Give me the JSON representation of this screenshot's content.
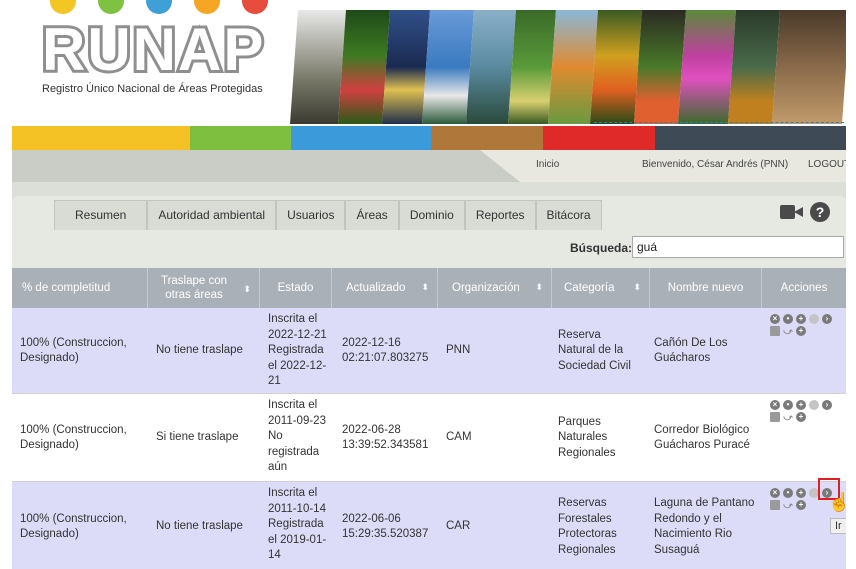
{
  "brand": {
    "logo_text": "RUNAP",
    "subtitle": "Registro Único Nacional de Áreas Protegidas",
    "circle_colors": [
      "#f3c623",
      "#7fc242",
      "#3fa0d8",
      "#f5a623",
      "#e74c3c"
    ],
    "colorbar": [
      "#f5c226",
      "#7fbf3f",
      "#3b9ad9",
      "#b0773a",
      "#e02a2a",
      "#3e4a56"
    ]
  },
  "topnav": {
    "home": "Inicio",
    "welcome": "Bienvenido, César Andrés (PNN)",
    "logout": "LOGOUT"
  },
  "tabs": [
    "Resumen",
    "Autoridad ambiental",
    "Usuarios",
    "Áreas",
    "Dominio",
    "Reportes",
    "Bitácora"
  ],
  "toolbar": {
    "video_icon": "video-camera-icon",
    "help_icon": "help-icon",
    "help_glyph": "?"
  },
  "search": {
    "label": "Búsqueda:",
    "value": "guá"
  },
  "table": {
    "headers": [
      "% de completitud",
      "Traslape con otras áreas",
      "Estado",
      "Actualizado",
      "Organización",
      "Categoría",
      "Nombre nuevo",
      "Acciones"
    ],
    "header_line2": "otras áreas",
    "header_line1": "Traslape con",
    "sortable": [
      false,
      true,
      false,
      true,
      true,
      true,
      false,
      false
    ],
    "header_color": "#aab0b8",
    "odd_row_color": "#dcdcf8",
    "rows": [
      {
        "completitud": [
          "100% (Construccion,",
          "Designado)"
        ],
        "traslape": "No tiene traslape",
        "estado": [
          "Inscrita el",
          "2022-12-21",
          "Registrada",
          "el 2022-12-",
          "21"
        ],
        "actualizado": [
          "2022-12-16",
          "02:21:07.803275"
        ],
        "organizacion": "PNN",
        "categoria": [
          "Reserva",
          "Natural de la",
          "Sociedad Civil"
        ],
        "nombre": [
          "Cañón De Los",
          "Guácharos"
        ]
      },
      {
        "completitud": [
          "100% (Construccion,",
          "Designado)"
        ],
        "traslape": "Si tiene traslape",
        "estado": [
          "Inscrita el",
          "2011-09-23",
          "No",
          "registrada",
          "aún"
        ],
        "actualizado": [
          "2022-06-28",
          "13:39:52.343581"
        ],
        "organizacion": "CAM",
        "categoria": [
          "Parques",
          "Naturales",
          "Regionales"
        ],
        "nombre": [
          "Corredor Biológico",
          "Guácharos Puracé"
        ]
      },
      {
        "completitud": [
          "100% (Construccion,",
          "Designado)"
        ],
        "traslape": "No tiene traslape",
        "estado": [
          "Inscrita el",
          "2011-10-14",
          "Registrada",
          "el 2019-01-",
          "14"
        ],
        "actualizado": [
          "2022-06-06",
          "15:29:35.520387"
        ],
        "organizacion": "CAR",
        "categoria": [
          "Reservas",
          "Forestales",
          "Protectoras",
          "Regionales"
        ],
        "nombre": [
          "Laguna de Pantano",
          "Redondo y el",
          "Nacimiento Rio",
          "Susaguá"
        ]
      }
    ],
    "action_icons": [
      "delete-icon",
      "view-icon",
      "edit-icon",
      "disabled-icon",
      "go-icon",
      "image-icon",
      "link-icon",
      "add-icon"
    ]
  },
  "tooltip": "Ir",
  "highlight_color": "#e02020"
}
